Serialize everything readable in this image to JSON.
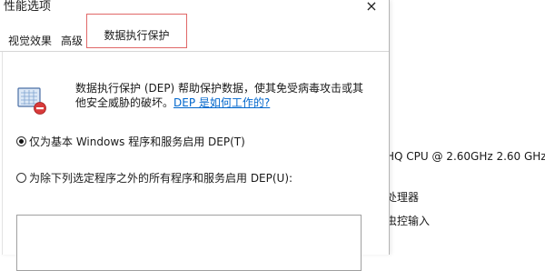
{
  "window": {
    "title": "性能选项",
    "close_glyph": "×"
  },
  "tabs": [
    {
      "label": "视觉效果",
      "active": false
    },
    {
      "label": "高级",
      "active": false
    },
    {
      "label": "数据执行保护",
      "active": true
    }
  ],
  "dep": {
    "icon": "dep-shield-monitor-icon",
    "description_line1": "数据执行保护 (DEP) 帮助保护数据，使其免受病毒攻击或其",
    "description_line2": "他安全威胁的破坏。",
    "link_text": "DEP 是如何工作的?"
  },
  "options": [
    {
      "label": "仅为基本 Windows 程序和服务启用 DEP(T)",
      "checked": true
    },
    {
      "label": "为除下列选定程序之外的所有程序和服务启用 DEP(U):",
      "checked": false
    }
  ],
  "background": {
    "cpu_line": "HQ CPU @ 2.60GHz   2.60 GHz",
    "processor_line": "处理器",
    "input_line": "虫控输入"
  },
  "colors": {
    "active_tab_border": "#e06868",
    "link": "#0066cc"
  }
}
